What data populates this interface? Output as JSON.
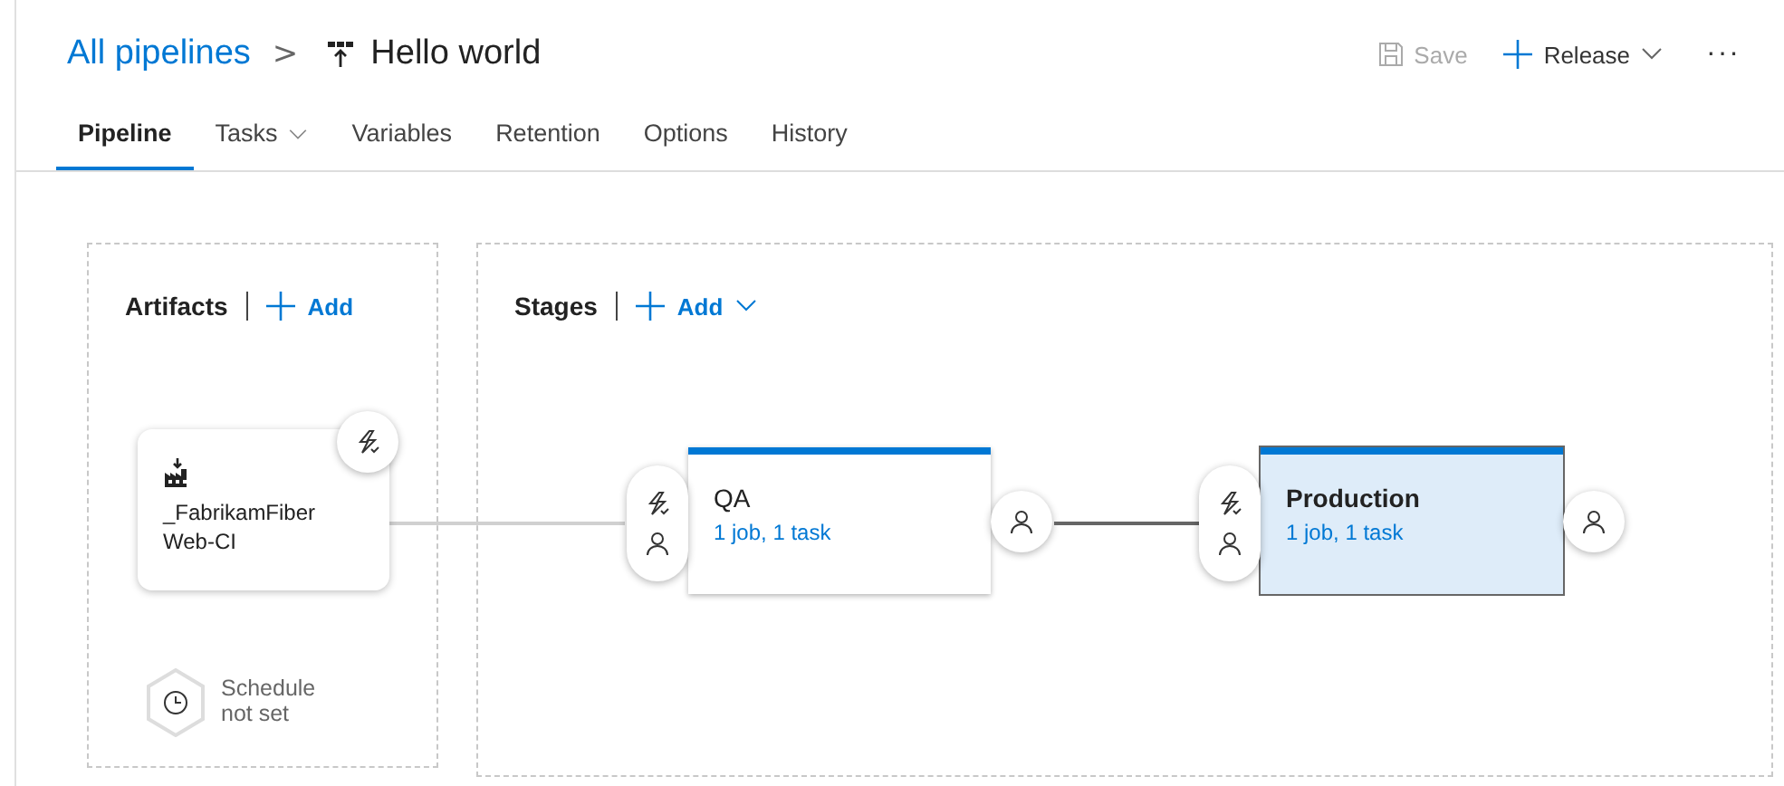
{
  "breadcrumb": {
    "parent": "All pipelines",
    "separator": ">",
    "title": "Hello world"
  },
  "toolbar": [
    {
      "kind": "save",
      "label": "Save",
      "disabled": true
    },
    {
      "kind": "release",
      "label": "Release",
      "disabled": false
    },
    {
      "kind": "more",
      "label": "···",
      "disabled": false
    }
  ],
  "tabs": [
    {
      "label": "Pipeline",
      "selected": true,
      "dropdown": false
    },
    {
      "label": "Tasks",
      "selected": false,
      "dropdown": true
    },
    {
      "label": "Variables",
      "selected": false,
      "dropdown": false
    },
    {
      "label": "Retention",
      "selected": false,
      "dropdown": false
    },
    {
      "label": "Options",
      "selected": false,
      "dropdown": false
    },
    {
      "label": "History",
      "selected": false,
      "dropdown": false
    }
  ],
  "artifacts": {
    "heading": "Artifacts",
    "add_label": "Add",
    "items": [
      {
        "name": "_FabrikamFiber Web-CI"
      }
    ],
    "schedule": "Schedule not set"
  },
  "stages": {
    "heading": "Stages",
    "add_label": "Add",
    "items": [
      {
        "name": "QA",
        "summary": "1 job, 1 task",
        "selected": false
      },
      {
        "name": "Production",
        "summary": "1 job, 1 task",
        "selected": true
      }
    ]
  }
}
